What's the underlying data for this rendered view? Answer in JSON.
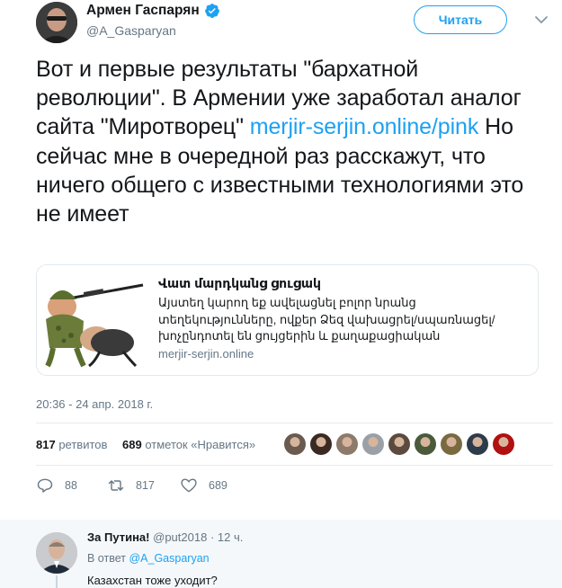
{
  "author": {
    "name": "Армен Гаспарян",
    "handle": "@A_Gasparyan",
    "verified": true
  },
  "follow_button": {
    "label": "Читать"
  },
  "tweet": {
    "text_before_link": "Вот и первые результаты \"бархатной революции\". В Армении уже заработал аналог сайта \"Миротворец\" ",
    "link": "merjir-serjin.online/pink",
    "text_after_link": " Но сейчас мне в очередной раз расскажут, что ничего общего с известными технологиями это не имеет"
  },
  "card": {
    "title": "Վատ մարդկանց ցուցակ",
    "description": "Այստեղ կարող եք ավելացնել բոլոր նրանց տեղեկությունները, ովքեր Ձեզ վախացրել/սպառնացել/խոչընդոտել են ցույցերին և քաղաքացիական անհնազանդությանը",
    "domain": "merjir-serjin.online"
  },
  "timestamp": "20:36 - 24 апр. 2018 г.",
  "stats": {
    "retweets_count": "817",
    "retweets_label": "ретвитов",
    "likes_count": "689",
    "likes_label": "отметок «Нравится»"
  },
  "liker_avatar_colors": [
    "#6b5a4e",
    "#3a2a22",
    "#8d7a6a",
    "#9aa0a6",
    "#5c4a3e",
    "#4a5a3a",
    "#7a6a40",
    "#2e3b4a",
    "#b01010"
  ],
  "actions": {
    "replies": "88",
    "retweets": "817",
    "likes": "689"
  },
  "reply": {
    "name": "За Путина!",
    "handle": "@put2018",
    "time": "· 12 ч.",
    "reply_prefix": "В ответ",
    "reply_mention": "@A_Gasparyan",
    "text": "Казахстан тоже уходит?"
  },
  "colors": {
    "accent": "#1da1f2",
    "muted": "#657786",
    "text": "#14171a"
  }
}
